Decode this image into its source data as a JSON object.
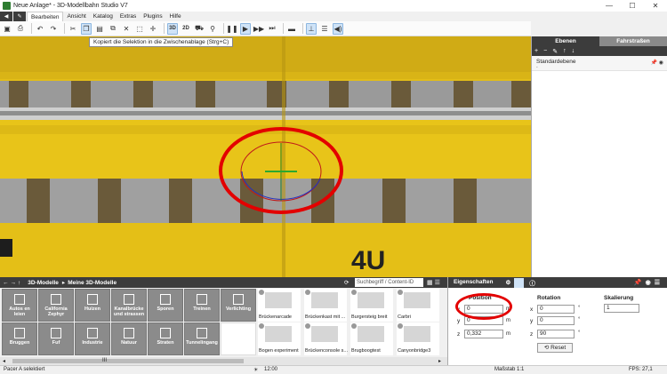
{
  "window": {
    "title": "Neue Anlage* - 3D-Modellbahn Studio V7",
    "controls": [
      "—",
      "☐",
      "✕"
    ]
  },
  "menu": {
    "items": [
      "Bearbeiten",
      "Ansicht",
      "Katalog",
      "Extras",
      "Plugins",
      "Hilfe"
    ],
    "active": "Bearbeiten"
  },
  "toolbar": {
    "view_3d": "3D",
    "view_2d": "2D",
    "tooltip": "Kopiert die Selektion in die Zwischenablage (Strg+C)"
  },
  "right_panel": {
    "tabs": [
      "Ebenen",
      "Fahrstraßen"
    ],
    "active_tab": "Ebenen",
    "layer_name": "Standardebene",
    "layer_sub": "-"
  },
  "catalog": {
    "breadcrumb": [
      "3D-Modelle",
      "Meine 3D-Modelle"
    ],
    "search_placeholder": "Suchbegriff / Content-ID",
    "categories": [
      "Autos en leien",
      "California Zephyr",
      "Huizen",
      "Kanalbrücke und strassen",
      "Sporen",
      "Treinen",
      "Verlichting",
      "Bruggen",
      "Fuf",
      "Industrie",
      "Natuur",
      "Straten",
      "Tunnelingang",
      ""
    ],
    "models": [
      "Brückenarcade",
      "Brückenkast mit ...",
      "Burgersteig breit",
      "Carbri",
      "Bogen experiment",
      "Brückenconsole s...",
      "Brugboogtest",
      "Canyonbridge3"
    ],
    "scroll_label": "III"
  },
  "properties": {
    "tab": "Eigenschaften",
    "position_label": "Position",
    "rotation_label": "Rotation",
    "scale_label": "Skalierung",
    "position": {
      "x": "0",
      "y": "0",
      "z": "0,332"
    },
    "rotation": {
      "x": "0",
      "y": "0",
      "z": "90"
    },
    "scale": "1",
    "unit_m": "m",
    "unit_deg": "°",
    "reset_label": "Reset"
  },
  "statusbar": {
    "selection": "Pacer A selektiert",
    "time": "12:00",
    "scale": "Maßstab 1:1",
    "fps": "FPS: 27,1"
  },
  "colors": {
    "wagon_yellow": "#e2bd18",
    "highlight_red": "#e30000",
    "dark_panel": "#3c3c3c"
  }
}
